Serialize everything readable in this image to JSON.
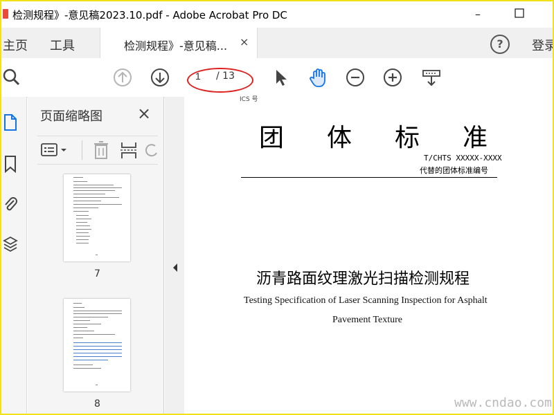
{
  "window": {
    "title": "检测规程》-意见稿2023.10.pdf - Adobe Acrobat Pro DC",
    "minimize_label": "–",
    "maximize_label": "☐"
  },
  "menu": {
    "home_label": "主页",
    "tools_label": "工具",
    "doc_tab_label": "检测规程》-意见稿...",
    "close_tab_label": "×",
    "help_label": "?",
    "login_label": "登录"
  },
  "toolbar": {
    "current_page": "1",
    "page_total": "/ 13"
  },
  "thumbnails": {
    "panel_title": "页面缩略图",
    "close_label": "×",
    "pages": [
      {
        "number": "7"
      },
      {
        "number": "8"
      }
    ]
  },
  "document": {
    "ics_label": "ICS 号",
    "title_chars": [
      "团",
      "体",
      "标",
      "准"
    ],
    "standard_number": "T/CHTS XXXXX-XXXX",
    "replaces": "代替的团体标准编号",
    "title_cn": "沥青路面纹理激光扫描检测规程",
    "title_en_line1": "Testing Specification of Laser Scanning Inspection for Asphalt",
    "title_en_line2": "Pavement Texture"
  },
  "watermark": "www.cndao.com",
  "colors": {
    "frame_border": "#f2e11a",
    "accent_blue": "#1473e6",
    "annotation_red": "#e02020"
  }
}
